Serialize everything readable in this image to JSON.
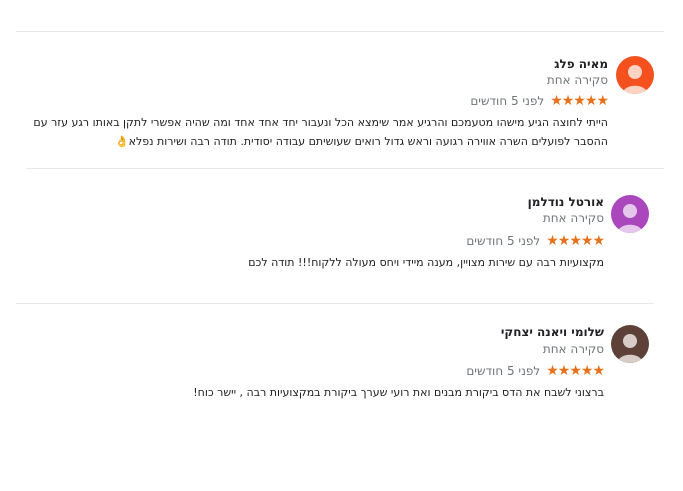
{
  "reviews": [
    {
      "name": "מאיה פלג",
      "review_count": "סקירה אחת",
      "stars": "★★★★★",
      "rating": 5,
      "date": "לפני 5 חודשים",
      "text": "הייתי לחוצה הגיע מישהו מטעמכם והרגיע אמר שימצא הכל ונעבור יחד אחד אחד ומה שהיה אפשרי לתקן באותו רגע עזר עם ההסבר לפועלים השרה אווירה רגועה וראש גדול רואים שעושיתם עבודה יסודית. תודה רבה ושירות נפלא👌",
      "avatar_color": "#f4511e"
    },
    {
      "name": "אורטל נודלמן",
      "review_count": "סקירה אחת",
      "stars": "★★★★★",
      "rating": 5,
      "date": "לפני 5 חודשים",
      "text": "מקצועיות רבה עם שירות מצויין, מענה מיידי ויחס מעולה ללקוח!!! תודה לכם",
      "avatar_color": "#ab47bc"
    },
    {
      "name": "שלומי ויאנה יצחקי",
      "review_count": "סקירה אחת",
      "stars": "★★★★★",
      "rating": 5,
      "date": "לפני 5 חודשים",
      "text": "ברצוני לשבח את הדס ביקורת מבנים ואת רועי שערך ביקורת במקצועיות רבה , יישר כוח!",
      "avatar_color": "#5d4037"
    }
  ]
}
